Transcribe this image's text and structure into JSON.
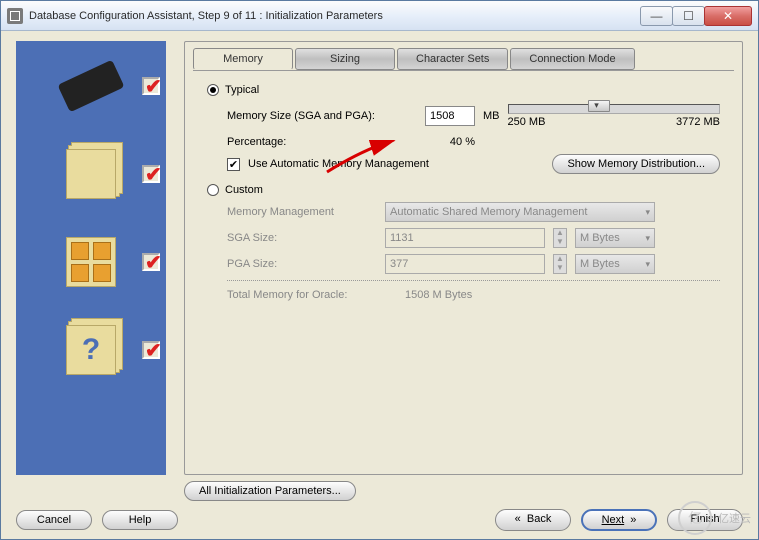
{
  "window": {
    "title": "Database Configuration Assistant, Step 9 of 11 : Initialization Parameters"
  },
  "tabs": {
    "memory": "Memory",
    "sizing": "Sizing",
    "charsets": "Character Sets",
    "connmode": "Connection Mode"
  },
  "typical": {
    "label": "Typical",
    "memsize_label": "Memory Size (SGA and PGA):",
    "memsize_value": "1508",
    "memsize_unit": "MB",
    "pct_label": "Percentage:",
    "pct_value": "40 %",
    "slider_min": "250 MB",
    "slider_max": "3772 MB",
    "auto_label": "Use Automatic Memory Management",
    "show_btn": "Show Memory Distribution..."
  },
  "custom": {
    "label": "Custom",
    "mm_label": "Memory Management",
    "mm_value": "Automatic Shared Memory Management",
    "sga_label": "SGA Size:",
    "sga_value": "1131",
    "sga_unit": "M Bytes",
    "pga_label": "PGA Size:",
    "pga_value": "377",
    "pga_unit": "M Bytes",
    "total_label": "Total Memory for Oracle:",
    "total_value": "1508 M Bytes"
  },
  "footer": {
    "all_params": "All Initialization Parameters...",
    "cancel": "Cancel",
    "help": "Help",
    "back": "Back",
    "next": "Next",
    "finish": "Finish"
  },
  "watermark": {
    "icon": "亿",
    "text": "亿速云"
  }
}
